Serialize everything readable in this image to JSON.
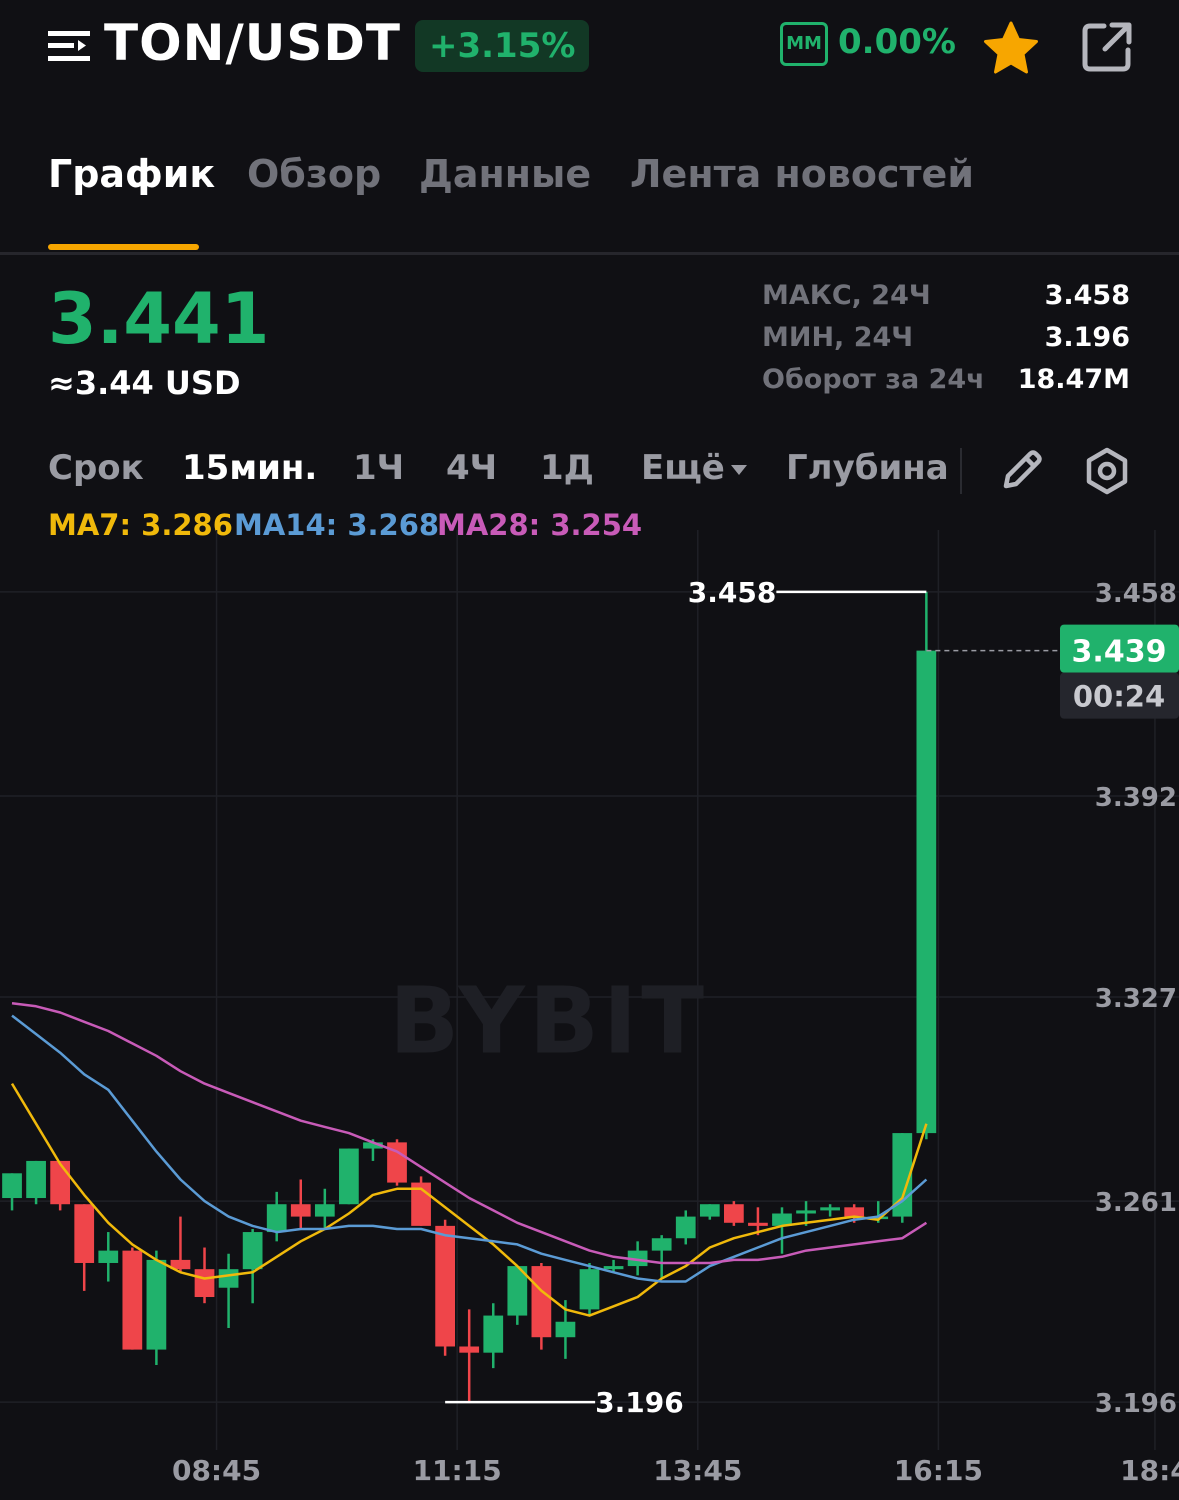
{
  "header": {
    "pair": "TON/USDT",
    "change": "+3.15%",
    "mm_label": "MM",
    "mm_value": "0.00%"
  },
  "tabs": [
    {
      "label": "График",
      "active": true
    },
    {
      "label": "Обзор",
      "active": false
    },
    {
      "label": "Данные",
      "active": false
    },
    {
      "label": "Лента новостей",
      "active": false
    }
  ],
  "ticker": {
    "price": "3.441",
    "price_usd": "≈3.44 USD",
    "stats": [
      {
        "label": "МАКС, 24Ч",
        "value": "3.458"
      },
      {
        "label": "МИН, 24Ч",
        "value": "3.196"
      },
      {
        "label": "Оборот за 24ч",
        "value": "18.47M"
      }
    ]
  },
  "toolbar": {
    "term_label": "Срок",
    "timeframes": [
      {
        "label": "15мин.",
        "selected": true
      },
      {
        "label": "1Ч",
        "selected": false
      },
      {
        "label": "4Ч",
        "selected": false
      },
      {
        "label": "1Д",
        "selected": false
      }
    ],
    "more_label": "Ещё",
    "depth_label": "Глубина"
  },
  "ma_legend": [
    {
      "label": "MA7: 3.286",
      "color": "#f0b90b"
    },
    {
      "label": "MA14: 3.268",
      "color": "#5b9bd5"
    },
    {
      "label": "MA28: 3.254",
      "color": "#c85bb8"
    }
  ],
  "colors": {
    "up": "#20b26c",
    "down": "#ef454a",
    "accent": "#f7a600"
  },
  "chart_data": {
    "type": "candlestick",
    "watermark": "BYBIT",
    "ylim": [
      3.187,
      3.478
    ],
    "y_ticks": [
      "3.458",
      "3.392",
      "3.327",
      "3.261",
      "3.196"
    ],
    "x_ticks": [
      "08:45",
      "11:15",
      "13:45",
      "16:15",
      "18:4"
    ],
    "x_tick_index": [
      8.5,
      18.5,
      28.5,
      38.5,
      47.5
    ],
    "x_visible": [
      -0.5,
      48.5
    ],
    "high_marker": {
      "label": "3.458",
      "value": 3.458,
      "index": 38
    },
    "low_marker": {
      "label": "3.196",
      "value": 3.196,
      "index": 18
    },
    "last_price": {
      "label": "3.439",
      "value": 3.439,
      "countdown": "00:24"
    },
    "candles": [
      {
        "o": 3.262,
        "h": 3.27,
        "l": 3.258,
        "c": 3.27
      },
      {
        "o": 3.262,
        "h": 3.274,
        "l": 3.26,
        "c": 3.274
      },
      {
        "o": 3.274,
        "h": 3.274,
        "l": 3.258,
        "c": 3.26
      },
      {
        "o": 3.26,
        "h": 3.26,
        "l": 3.232,
        "c": 3.241
      },
      {
        "o": 3.241,
        "h": 3.251,
        "l": 3.235,
        "c": 3.245
      },
      {
        "o": 3.245,
        "h": 3.246,
        "l": 3.213,
        "c": 3.213
      },
      {
        "o": 3.213,
        "h": 3.245,
        "l": 3.208,
        "c": 3.242
      },
      {
        "o": 3.242,
        "h": 3.256,
        "l": 3.238,
        "c": 3.239
      },
      {
        "o": 3.239,
        "h": 3.246,
        "l": 3.228,
        "c": 3.23
      },
      {
        "o": 3.233,
        "h": 3.244,
        "l": 3.22,
        "c": 3.239
      },
      {
        "o": 3.239,
        "h": 3.252,
        "l": 3.228,
        "c": 3.251
      },
      {
        "o": 3.251,
        "h": 3.264,
        "l": 3.248,
        "c": 3.26
      },
      {
        "o": 3.26,
        "h": 3.268,
        "l": 3.252,
        "c": 3.256
      },
      {
        "o": 3.256,
        "h": 3.265,
        "l": 3.252,
        "c": 3.26
      },
      {
        "o": 3.26,
        "h": 3.278,
        "l": 3.26,
        "c": 3.278
      },
      {
        "o": 3.278,
        "h": 3.281,
        "l": 3.274,
        "c": 3.28
      },
      {
        "o": 3.28,
        "h": 3.281,
        "l": 3.266,
        "c": 3.267
      },
      {
        "o": 3.267,
        "h": 3.269,
        "l": 3.253,
        "c": 3.253
      },
      {
        "o": 3.253,
        "h": 3.255,
        "l": 3.211,
        "c": 3.214
      },
      {
        "o": 3.214,
        "h": 3.226,
        "l": 3.196,
        "c": 3.212
      },
      {
        "o": 3.212,
        "h": 3.228,
        "l": 3.207,
        "c": 3.224
      },
      {
        "o": 3.224,
        "h": 3.24,
        "l": 3.221,
        "c": 3.24
      },
      {
        "o": 3.24,
        "h": 3.241,
        "l": 3.213,
        "c": 3.217
      },
      {
        "o": 3.217,
        "h": 3.229,
        "l": 3.21,
        "c": 3.222
      },
      {
        "o": 3.226,
        "h": 3.241,
        "l": 3.224,
        "c": 3.239
      },
      {
        "o": 3.239,
        "h": 3.242,
        "l": 3.238,
        "c": 3.24
      },
      {
        "o": 3.24,
        "h": 3.248,
        "l": 3.237,
        "c": 3.245
      },
      {
        "o": 3.245,
        "h": 3.25,
        "l": 3.236,
        "c": 3.249
      },
      {
        "o": 3.249,
        "h": 3.258,
        "l": 3.247,
        "c": 3.256
      },
      {
        "o": 3.256,
        "h": 3.26,
        "l": 3.255,
        "c": 3.26
      },
      {
        "o": 3.26,
        "h": 3.261,
        "l": 3.253,
        "c": 3.254
      },
      {
        "o": 3.254,
        "h": 3.259,
        "l": 3.25,
        "c": 3.253
      },
      {
        "o": 3.253,
        "h": 3.259,
        "l": 3.244,
        "c": 3.257
      },
      {
        "o": 3.257,
        "h": 3.261,
        "l": 3.253,
        "c": 3.258
      },
      {
        "o": 3.258,
        "h": 3.26,
        "l": 3.256,
        "c": 3.259
      },
      {
        "o": 3.259,
        "h": 3.26,
        "l": 3.254,
        "c": 3.256
      },
      {
        "o": 3.256,
        "h": 3.261,
        "l": 3.254,
        "c": 3.256
      },
      {
        "o": 3.256,
        "h": 3.283,
        "l": 3.254,
        "c": 3.283
      },
      {
        "o": 3.283,
        "h": 3.458,
        "l": 3.281,
        "c": 3.439
      }
    ],
    "candles_start_index": 0,
    "ma": [
      {
        "name": "MA7",
        "color": "#f0b90b",
        "values": [
          3.299,
          3.286,
          3.273,
          3.263,
          3.254,
          3.247,
          3.242,
          3.238,
          3.236,
          3.237,
          3.238,
          3.243,
          3.248,
          3.252,
          3.257,
          3.263,
          3.265,
          3.265,
          3.259,
          3.253,
          3.247,
          3.24,
          3.232,
          3.226,
          3.224,
          3.227,
          3.23,
          3.236,
          3.24,
          3.246,
          3.249,
          3.251,
          3.253,
          3.254,
          3.255,
          3.256,
          3.255,
          3.262,
          3.286
        ]
      },
      {
        "name": "MA14",
        "color": "#5b9bd5",
        "values": [
          3.321,
          3.315,
          3.309,
          3.302,
          3.297,
          3.287,
          3.277,
          3.268,
          3.261,
          3.256,
          3.253,
          3.251,
          3.252,
          3.252,
          3.253,
          3.253,
          3.252,
          3.252,
          3.25,
          3.249,
          3.248,
          3.247,
          3.244,
          3.242,
          3.24,
          3.238,
          3.236,
          3.235,
          3.235,
          3.24,
          3.243,
          3.246,
          3.249,
          3.251,
          3.253,
          3.255,
          3.256,
          3.261,
          3.268
        ]
      },
      {
        "name": "MA28",
        "color": "#c85bb8",
        "values": [
          3.325,
          3.324,
          3.322,
          3.319,
          3.316,
          3.312,
          3.308,
          3.303,
          3.299,
          3.296,
          3.293,
          3.29,
          3.287,
          3.285,
          3.283,
          3.28,
          3.277,
          3.272,
          3.267,
          3.262,
          3.258,
          3.254,
          3.251,
          3.248,
          3.245,
          3.243,
          3.242,
          3.241,
          3.241,
          3.241,
          3.242,
          3.242,
          3.243,
          3.245,
          3.246,
          3.247,
          3.248,
          3.249,
          3.254
        ]
      }
    ]
  }
}
